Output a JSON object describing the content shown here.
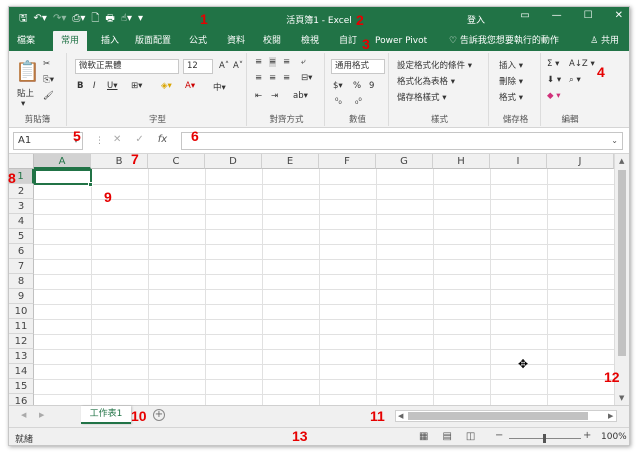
{
  "qat": {
    "save": "🖫",
    "undo": "↶▾",
    "redo": "↷▾",
    "preview": "⎙▾",
    "newfile": "🗋",
    "print": "🖶",
    "touch": "☝▾",
    "more": "▾"
  },
  "title": "活頁簿1  -  Excel",
  "login": "登入",
  "window_buttons": {
    "ribbon_options": "▭",
    "minimize": "—",
    "maximize": "☐",
    "close": "✕"
  },
  "tabs": [
    "檔案",
    "常用",
    "插入",
    "版面配置",
    "公式",
    "資料",
    "校閱",
    "檢視",
    "自訂",
    "Power Pivot"
  ],
  "active_tab": "常用",
  "tell_me": "♡ 告訴我您想要執行的動作",
  "share": "♙ 共用",
  "ribbon": {
    "clipboard": {
      "label": "剪貼簿",
      "paste": "貼上",
      "paste_arrow": "▾",
      "cut": "✂",
      "copy": "⎘▾",
      "painter": "🖌"
    },
    "font": {
      "label": "字型",
      "name": "微軟正黑體",
      "size": "12",
      "grow": "A˄",
      "shrink": "A˅",
      "bold": "B",
      "italic": "I",
      "underline": "U▾",
      "border": "⊞▾",
      "fill": "◈▾",
      "color": "A▾",
      "phonetic": "中▾"
    },
    "alignment": {
      "label": "對齊方式",
      "top": "≡",
      "middle": "≡",
      "bottom": "≡",
      "wrap": "⤶",
      "left": "≡",
      "center": "≡",
      "right": "≡",
      "merge": "⊟▾",
      "indent_dec": "⇤",
      "indent_inc": "⇥",
      "orient": "ab▾"
    },
    "number": {
      "label": "數值",
      "format": "通用格式",
      "currency": "$▾",
      "percent": "%",
      "comma": "9",
      "inc": "⁰₀",
      "dec": "₀⁰"
    },
    "styles": {
      "label": "樣式",
      "conditional": "設定格式化的條件 ▾",
      "as_table": "格式化為表格 ▾",
      "cell_styles": "儲存格樣式 ▾"
    },
    "cells": {
      "label": "儲存格",
      "insert": "插入 ▾",
      "delete": "刪除 ▾",
      "format": "格式 ▾"
    },
    "editing": {
      "label": "編輯",
      "sum": "Σ ▾",
      "sort": "A↓Z ▾",
      "fill": "⬇ ▾",
      "find": "⌕ ▾",
      "clear": "◆ ▾"
    }
  },
  "formula_bar": {
    "name_box": "A1",
    "name_arrow": "▾",
    "separator": "⋮",
    "cancel": "✕",
    "enter": "✓",
    "fx": "fx",
    "expand": "⌄"
  },
  "columns": [
    "A",
    "B",
    "C",
    "D",
    "E",
    "F",
    "G",
    "H",
    "I",
    "J"
  ],
  "rows": [
    "1",
    "2",
    "3",
    "4",
    "5",
    "6",
    "7",
    "8",
    "9",
    "10",
    "11",
    "12",
    "13",
    "14",
    "15",
    "16"
  ],
  "selected_cell": "A1",
  "sheet_tab": "工作表1",
  "add_sheet": "+",
  "status": {
    "ready": "就緒",
    "zoom_minus": "−",
    "zoom_plus": "+",
    "zoom": "100%"
  },
  "annotations": [
    "1",
    "2",
    "3",
    "4",
    "5",
    "6",
    "7",
    "8",
    "9",
    "10",
    "11",
    "12",
    "13"
  ],
  "colors": {
    "excel_green": "#217346",
    "annotation_red": "#e60000"
  }
}
